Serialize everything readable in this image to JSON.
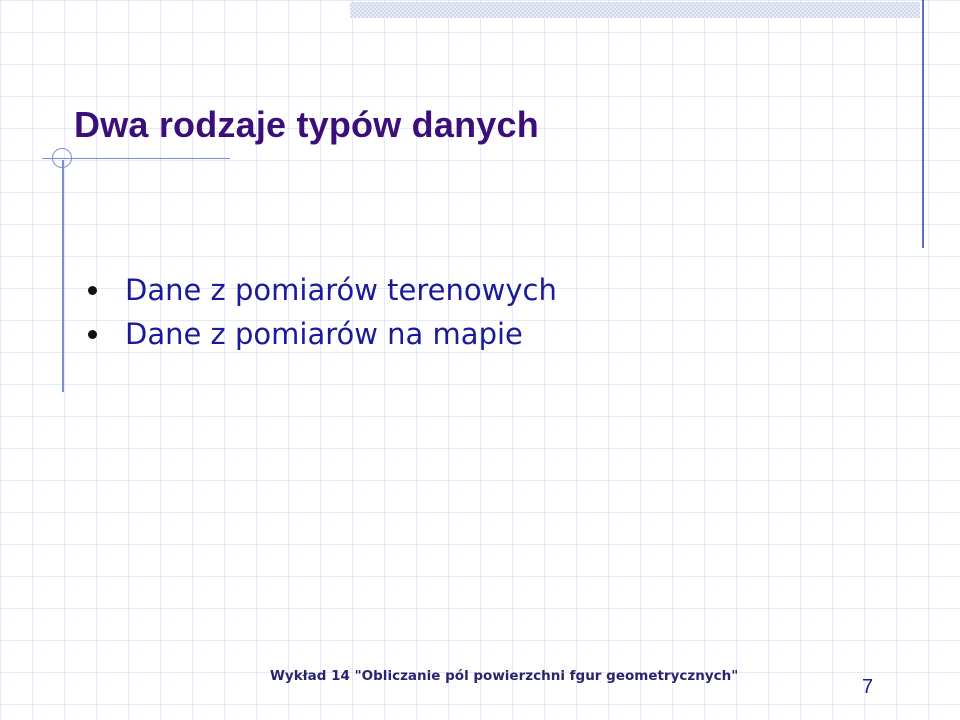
{
  "slide": {
    "title": "Dwa rodzaje typów danych",
    "bullets": [
      {
        "text": "Dane z pomiarów terenowych"
      },
      {
        "text": "Dane z pomiarów na mapie"
      }
    ],
    "footer": "Wykład 14 \"Obliczanie pól powierzchni fgur geometrycznych\"",
    "page_number": "7"
  },
  "colors": {
    "title": "#3b0f7a",
    "body_text": "#1a1a9a",
    "accent_line": "#7b8ed6",
    "grid": "#cdd7f0"
  }
}
